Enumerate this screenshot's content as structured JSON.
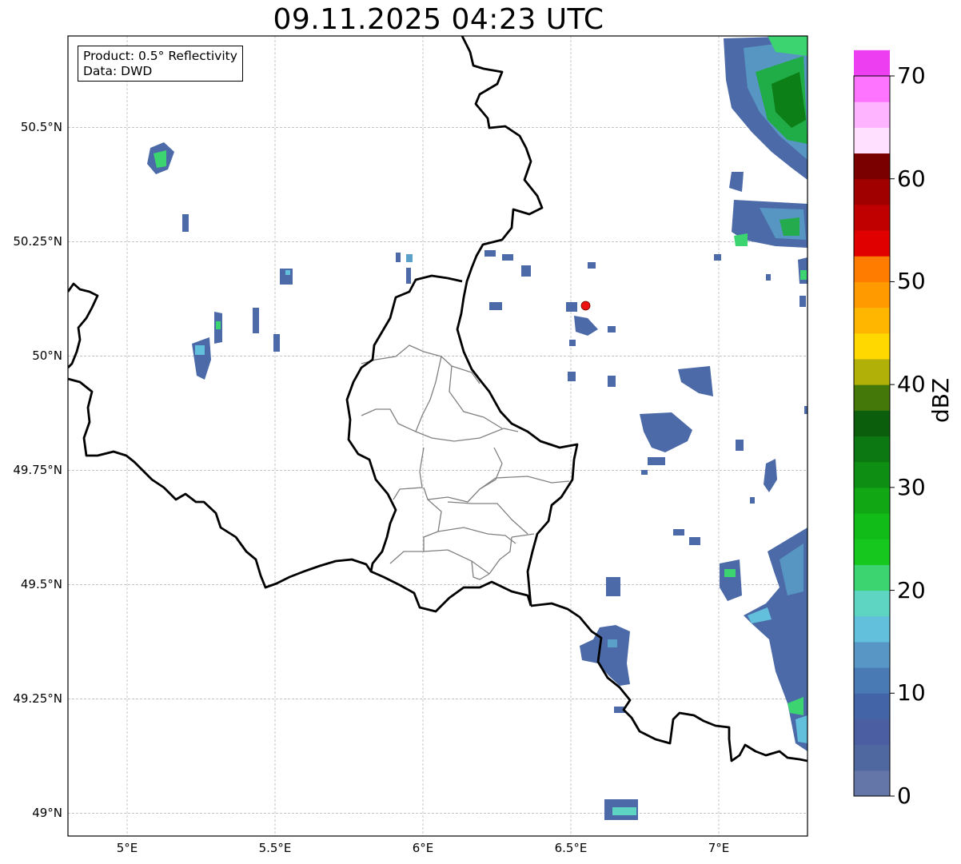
{
  "title": "09.11.2025 04:23 UTC",
  "info": {
    "product": "Product: 0.5° Reflectivity",
    "source": "Data: DWD"
  },
  "map": {
    "lon_range": [
      4.8,
      7.3
    ],
    "lat_range": [
      48.95,
      50.7
    ],
    "lat_ticks": [
      {
        "value": 50.5,
        "label": "50.5°N"
      },
      {
        "value": 50.25,
        "label": "50.25°N"
      },
      {
        "value": 50.0,
        "label": "50°N"
      },
      {
        "value": 49.75,
        "label": "49.75°N"
      },
      {
        "value": 49.5,
        "label": "49.5°N"
      },
      {
        "value": 49.25,
        "label": "49.25°N"
      },
      {
        "value": 49.0,
        "label": "49°N"
      }
    ],
    "lon_ticks": [
      {
        "value": 5.0,
        "label": "5°E"
      },
      {
        "value": 5.5,
        "label": "5.5°E"
      },
      {
        "value": 6.0,
        "label": "6°E"
      },
      {
        "value": 6.5,
        "label": "6.5°E"
      },
      {
        "value": 7.0,
        "label": "7°E"
      }
    ],
    "grid": true,
    "radar_site": {
      "lon": 6.55,
      "lat": 50.11,
      "color": "#ee1111"
    },
    "border_color": "#000000",
    "admin_border_color": "#808080"
  },
  "colorbar": {
    "label": "dBZ",
    "min": 0,
    "max": 70,
    "step": 2.5,
    "ticks": [
      0,
      10,
      20,
      30,
      40,
      50,
      60,
      70
    ],
    "colors": [
      "#6475a8",
      "#5068a0",
      "#4c5ea2",
      "#4464a8",
      "#4a7ab4",
      "#5896c6",
      "#62c0dc",
      "#5ed4c2",
      "#3cd470",
      "#16c81e",
      "#12bc18",
      "#10a614",
      "#0e8e12",
      "#0c7812",
      "#0a5e0c",
      "#447808",
      "#b0b008",
      "#ffd800",
      "#ffb600",
      "#ff9a00",
      "#ff7c00",
      "#e00000",
      "#c00000",
      "#a00000",
      "#7a0000",
      "#ffe0ff",
      "#ffb4ff",
      "#ff74ff",
      "#ee3ef2"
    ]
  }
}
